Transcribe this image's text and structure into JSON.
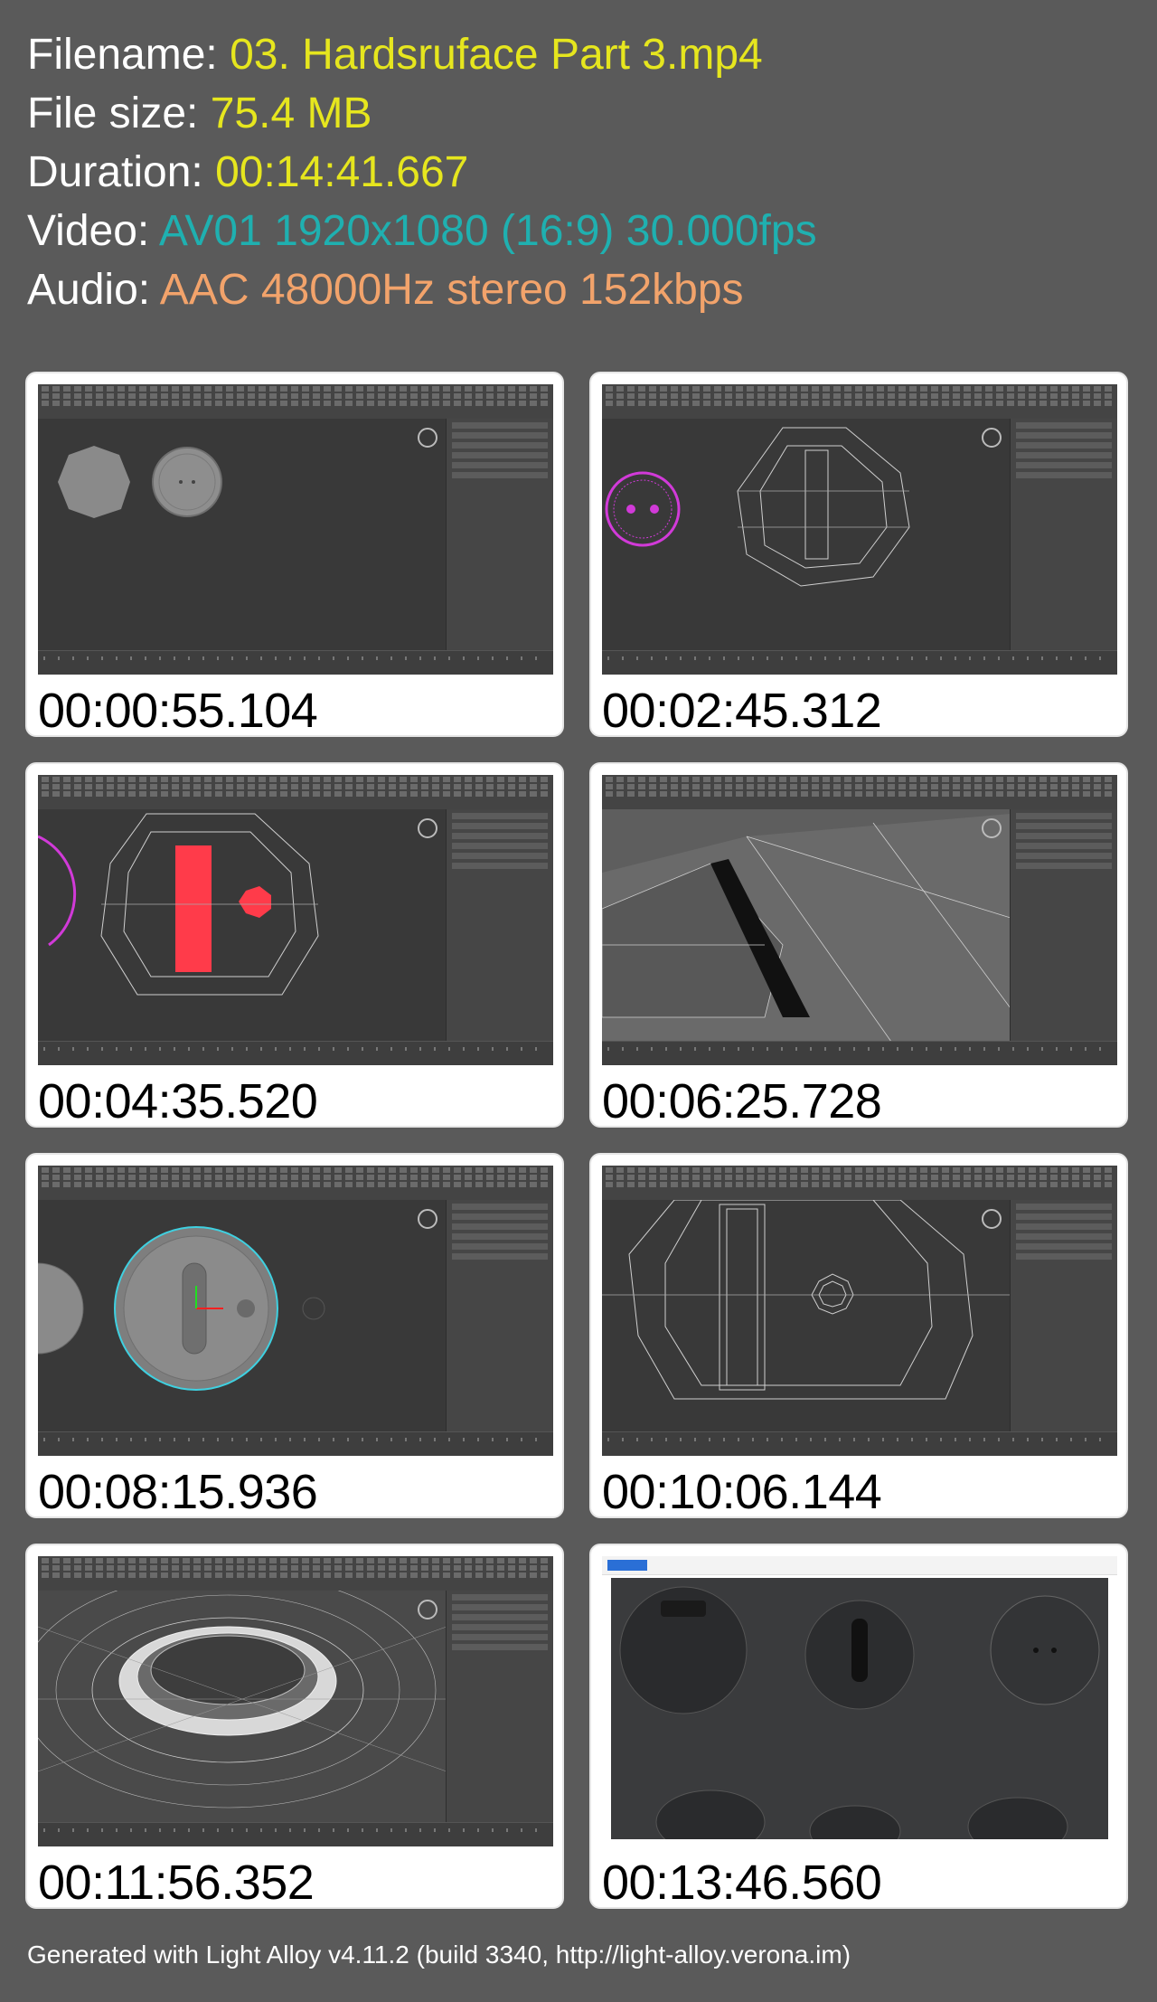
{
  "info": {
    "filename_label": "Filename: ",
    "filename_value": "03. Hardsruface Part 3.mp4",
    "filesize_label": "File size: ",
    "filesize_value": "75.4 MB",
    "duration_label": "Duration: ",
    "duration_value": "00:14:41.667",
    "video_label": "Video: ",
    "video_value": "AV01 1920x1080 (16:9) 30.000fps",
    "audio_label": "Audio: ",
    "audio_value": "AAC 48000Hz stereo 152kbps"
  },
  "thumbnails": [
    {
      "timestamp": "00:00:55.104"
    },
    {
      "timestamp": "00:02:45.312"
    },
    {
      "timestamp": "00:04:35.520"
    },
    {
      "timestamp": "00:06:25.728"
    },
    {
      "timestamp": "00:08:15.936"
    },
    {
      "timestamp": "00:10:06.144"
    },
    {
      "timestamp": "00:11:56.352"
    },
    {
      "timestamp": "00:13:46.560"
    }
  ],
  "footer": "Generated with Light Alloy v4.11.2 (build 3340, http://light-alloy.verona.im)",
  "colors": {
    "background": "#5a5a5a",
    "filename_value": "#e6e61e",
    "video_value": "#1fb0b0",
    "audio_value": "#f2a36b",
    "selection_magenta": "#d13ad8",
    "selection_red": "#ff3b4a",
    "selection_cyan": "#3fd0e0"
  }
}
